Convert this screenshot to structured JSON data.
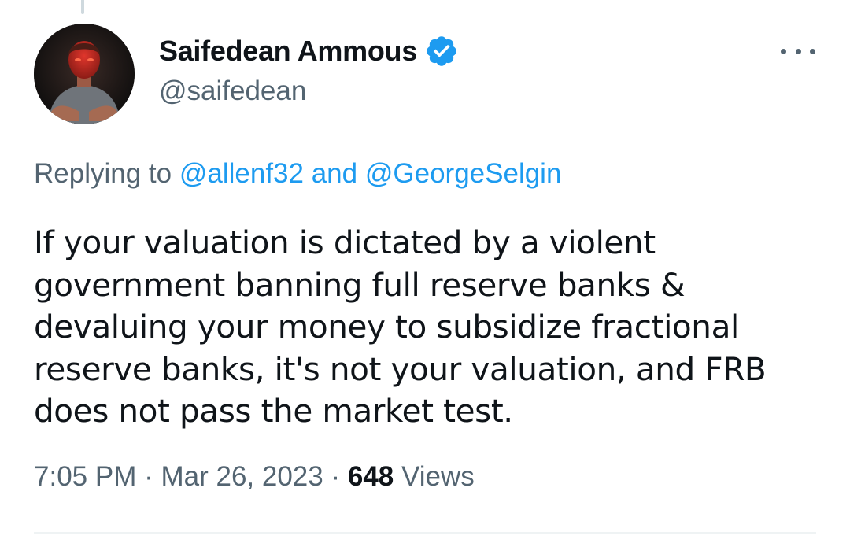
{
  "tweet": {
    "author": {
      "name": "Saifedean Ammous",
      "handle": "@saifedean",
      "verified_color": "#1d9bf0"
    },
    "more_icon": "ellipsis-icon",
    "reply_context": {
      "prefix": "Replying to",
      "mention_1": "@allenf32",
      "conjunction": "and",
      "mention_2": "@GeorgeSelgin"
    },
    "text_lines": [
      "If your valuation is dictated by a violent",
      "government banning full reserve banks &",
      "devaluing your money to subsidize fractional",
      "reserve banks, it's not your valuation, and FRB",
      "does not pass the market test."
    ],
    "time": "7:05 PM",
    "date": "Mar 26, 2023",
    "separator": "·",
    "views_count": "648",
    "views_label": "Views"
  },
  "colors": {
    "accent": "#1d9bf0",
    "secondary_text": "#536471",
    "primary_text": "#0f1419"
  }
}
